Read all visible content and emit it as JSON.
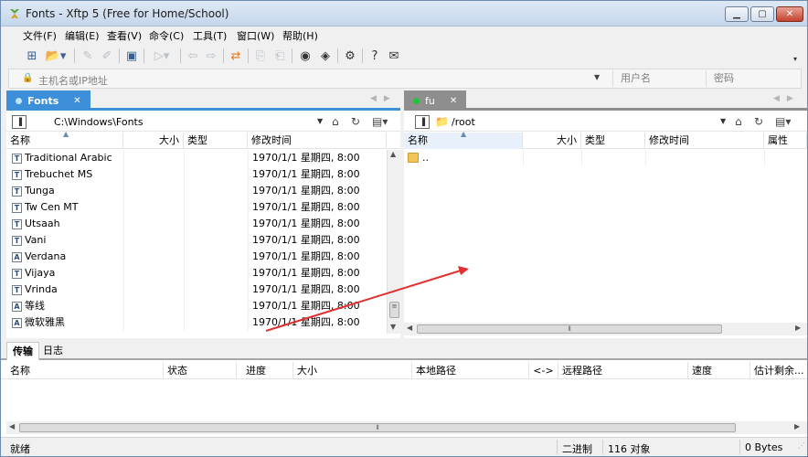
{
  "window": {
    "title": "Fonts - Xftp 5 (Free for Home/School)",
    "controls": [
      "minimize",
      "maximize",
      "close"
    ]
  },
  "menu": [
    "文件(F)",
    "编辑(E)",
    "查看(V)",
    "命令(C)",
    "工具(T)",
    "窗口(W)",
    "帮助(H)"
  ],
  "address": {
    "host_placeholder": "主机名或IP地址",
    "user_placeholder": "用户名",
    "password_placeholder": "密码"
  },
  "left_panel": {
    "tab_label": "Fonts",
    "path": "C:\\Windows\\Fonts",
    "columns": [
      "名称",
      "大小",
      "类型",
      "修改时间"
    ],
    "rows": [
      {
        "name": "Traditional Arabic",
        "modified": "1970/1/1 星期四, 8:00",
        "icon": "font-tt-icon"
      },
      {
        "name": "Trebuchet MS",
        "modified": "1970/1/1 星期四, 8:00",
        "icon": "font-tt-icon"
      },
      {
        "name": "Tunga",
        "modified": "1970/1/1 星期四, 8:00",
        "icon": "font-tt-icon"
      },
      {
        "name": "Tw Cen MT",
        "modified": "1970/1/1 星期四, 8:00",
        "icon": "font-tt-icon"
      },
      {
        "name": "Utsaah",
        "modified": "1970/1/1 星期四, 8:00",
        "icon": "font-tt-icon"
      },
      {
        "name": "Vani",
        "modified": "1970/1/1 星期四, 8:00",
        "icon": "font-tt-icon"
      },
      {
        "name": "Verdana",
        "modified": "1970/1/1 星期四, 8:00",
        "icon": "font-a-icon"
      },
      {
        "name": "Vijaya",
        "modified": "1970/1/1 星期四, 8:00",
        "icon": "font-tt-icon"
      },
      {
        "name": "Vrinda",
        "modified": "1970/1/1 星期四, 8:00",
        "icon": "font-tt-icon"
      },
      {
        "name": "等线",
        "modified": "1970/1/1 星期四, 8:00",
        "icon": "font-a-icon"
      },
      {
        "name": "微软雅黑",
        "modified": "1970/1/1 星期四, 8:00",
        "icon": "font-a-icon"
      }
    ]
  },
  "right_panel": {
    "tab_label": "fu",
    "path": "/root",
    "columns": [
      "名称",
      "大小",
      "类型",
      "修改时间",
      "属性"
    ],
    "rows": [
      {
        "name": "..",
        "icon": "folder-icon"
      }
    ]
  },
  "bottom": {
    "tabs": [
      "传输",
      "日志"
    ],
    "columns": [
      "名称",
      "状态",
      "进度",
      "大小",
      "本地路径",
      "<->",
      "远程路径",
      "速度",
      "估计剩余..."
    ]
  },
  "status": {
    "left": "就绪",
    "mode": "二进制",
    "objects": "116 对象",
    "size": "0 Bytes"
  },
  "colors": {
    "accent": "#3c8fd8",
    "annotation_arrow": "#e0302f",
    "connected_dot": "#22c33a"
  }
}
